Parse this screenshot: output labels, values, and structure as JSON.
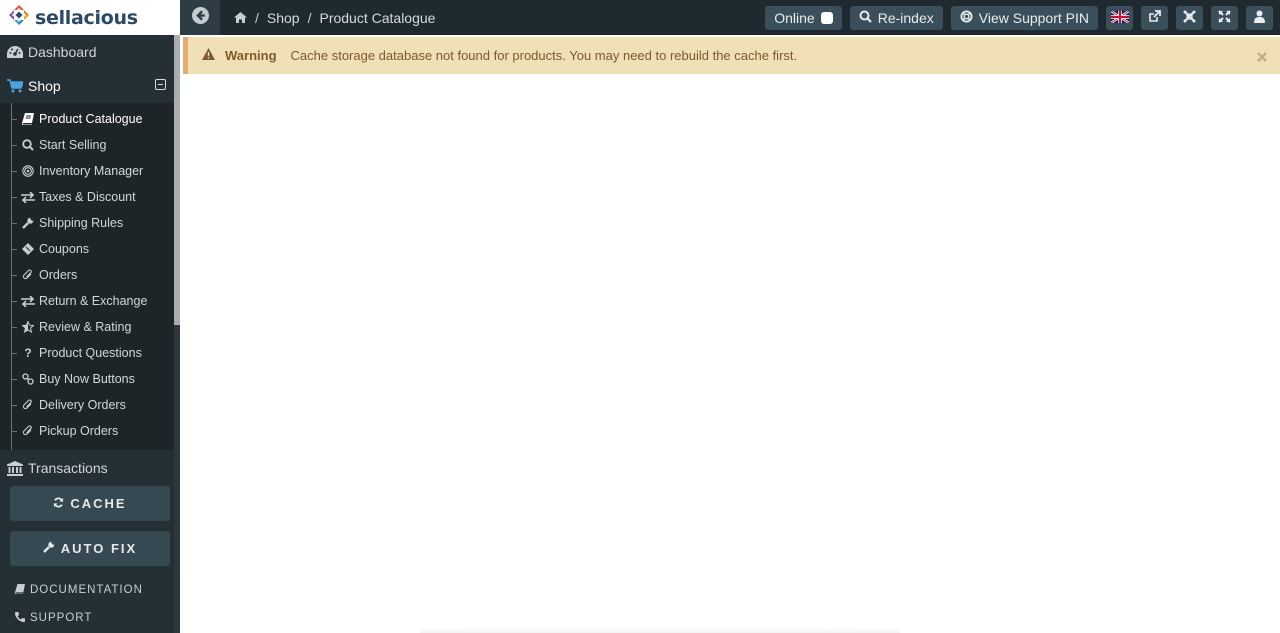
{
  "app": {
    "logo_text": "sellacious"
  },
  "topbar": {
    "breadcrumb": [
      {
        "label": "Shop"
      },
      {
        "label": "Product Catalogue"
      }
    ],
    "online_label": "Online",
    "reindex_label": "Re-index",
    "support_label": "View Support PIN",
    "icons": [
      "uk-flag-icon",
      "external-link-icon",
      "joomla-icon",
      "expand-icon",
      "user-icon"
    ]
  },
  "sidebar": {
    "dashboard": "Dashboard",
    "shop": "Shop",
    "items": [
      {
        "label": "Product Catalogue",
        "icon": "book-icon",
        "active": true
      },
      {
        "label": "Start Selling",
        "icon": "search-icon"
      },
      {
        "label": "Inventory Manager",
        "icon": "bullseye-icon"
      },
      {
        "label": "Taxes & Discount",
        "icon": "exchange-icon"
      },
      {
        "label": "Shipping Rules",
        "icon": "wrench-icon"
      },
      {
        "label": "Coupons",
        "icon": "ticket-icon"
      },
      {
        "label": "Orders",
        "icon": "paperclip-icon"
      },
      {
        "label": "Return & Exchange",
        "icon": "exchange-icon"
      },
      {
        "label": "Review & Rating",
        "icon": "star-icon"
      },
      {
        "label": "Product Questions",
        "icon": "question-icon"
      },
      {
        "label": "Buy Now Buttons",
        "icon": "link-icon"
      },
      {
        "label": "Delivery Orders",
        "icon": "paperclip-icon"
      },
      {
        "label": "Pickup Orders",
        "icon": "paperclip-icon"
      }
    ],
    "transactions": "Transactions",
    "cache_button": "CACHE",
    "autofix_button": "AUTO FIX",
    "documentation": "DOCUMENTATION",
    "support": "SUPPORT"
  },
  "alert": {
    "title": "Warning",
    "message": "Cache storage database not found for products. You may need to rebuild the cache first."
  },
  "colors": {
    "topbar": "#1f2a30",
    "sidebar": "#253036",
    "alert_bg": "#f1e0b6",
    "alert_border": "#e2ad6f",
    "alert_text": "#7a5a2f",
    "shop_icon": "#4aa3df"
  }
}
